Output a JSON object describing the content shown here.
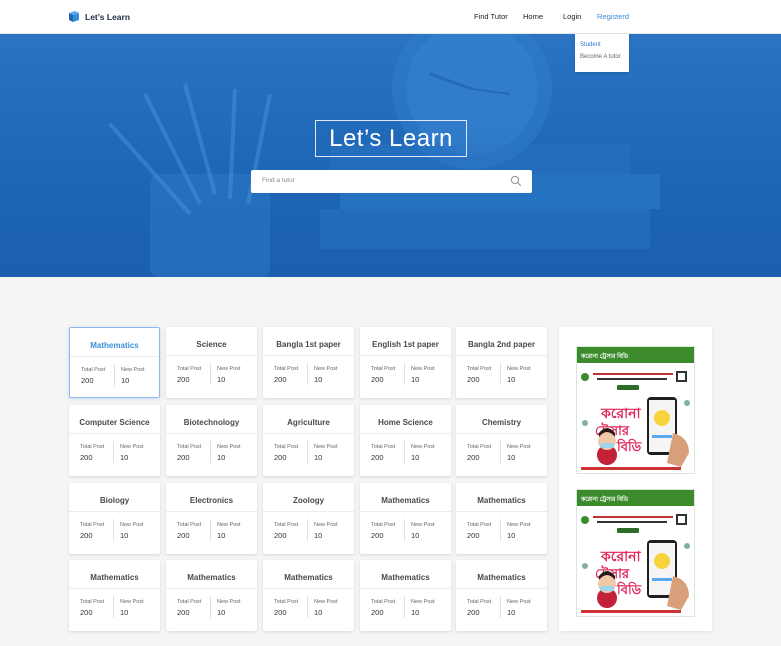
{
  "brand": {
    "name": "Let’s Learn",
    "color": "#1e66b6",
    "accent": "#3a8ed8"
  },
  "nav": {
    "find_tutor": "Find Tutor",
    "home": "Home",
    "login": "Login",
    "registered": "Registerd"
  },
  "dropdown": {
    "student": "Student",
    "become_tutor": "Become A tutor"
  },
  "hero": {
    "title": "Let’s Learn",
    "search_placeholder": "Find a tutor"
  },
  "stats": {
    "total_label": "Total Post",
    "new_label": "New Post"
  },
  "subjects": [
    {
      "name": "Mathematics",
      "total": "200",
      "new": "10"
    },
    {
      "name": "Science",
      "total": "200",
      "new": "10"
    },
    {
      "name": "Bangla 1st paper",
      "total": "200",
      "new": "10"
    },
    {
      "name": "English 1st paper",
      "total": "200",
      "new": "10"
    },
    {
      "name": "Bangla 2nd paper",
      "total": "200",
      "new": "10"
    },
    {
      "name": "Computer Science",
      "total": "200",
      "new": "10"
    },
    {
      "name": "Biotechnology",
      "total": "200",
      "new": "10"
    },
    {
      "name": "Agriculture",
      "total": "200",
      "new": "10"
    },
    {
      "name": "Home Science",
      "total": "200",
      "new": "10"
    },
    {
      "name": "Chemistry",
      "total": "200",
      "new": "10"
    },
    {
      "name": "Biology",
      "total": "200",
      "new": "10"
    },
    {
      "name": "Electronics",
      "total": "200",
      "new": "10"
    },
    {
      "name": "Zoology",
      "total": "200",
      "new": "10"
    },
    {
      "name": "Mathematics",
      "total": "200",
      "new": "10"
    },
    {
      "name": "Mathematics",
      "total": "200",
      "new": "10"
    },
    {
      "name": "Mathematics",
      "total": "200",
      "new": "10"
    },
    {
      "name": "Mathematics",
      "total": "200",
      "new": "10"
    },
    {
      "name": "Mathematics",
      "total": "200",
      "new": "10"
    },
    {
      "name": "Mathematics",
      "total": "200",
      "new": "10"
    },
    {
      "name": "Mathematics",
      "total": "200",
      "new": "10"
    }
  ],
  "ads": [
    {
      "header": "করোনা ট্রেসার বিডি",
      "big_text": "করোনা ট্রেসার বিডি"
    },
    {
      "header": "করোনা ট্রেসার বিডি",
      "big_text": "করোনা ট্রেসার বিডি"
    }
  ]
}
